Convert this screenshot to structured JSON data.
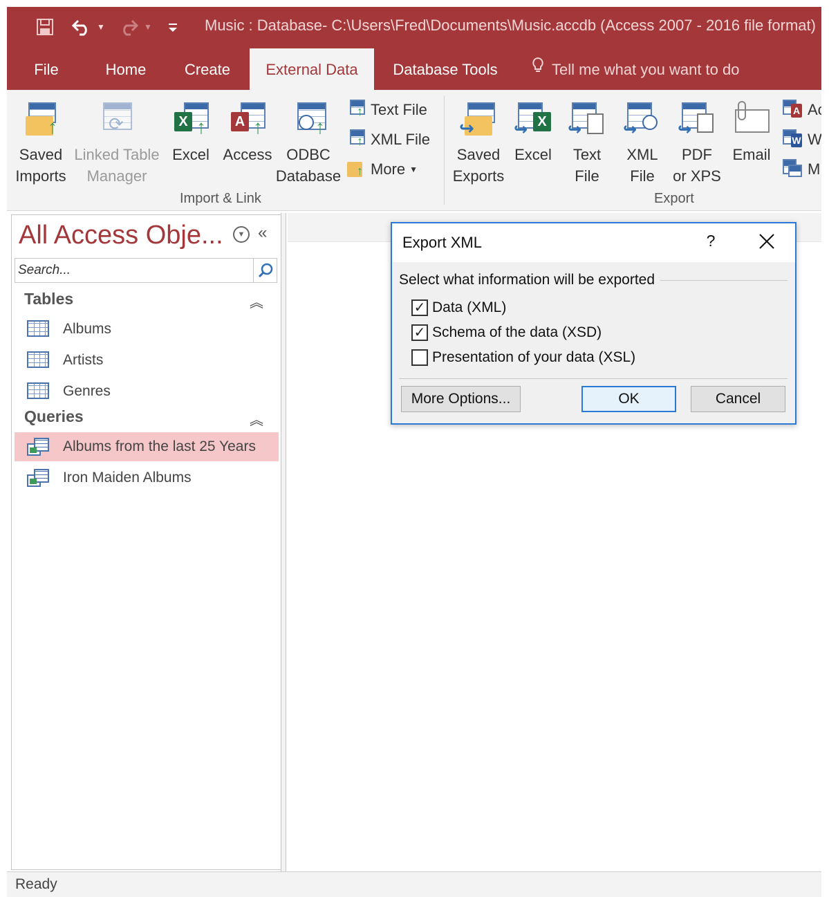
{
  "window": {
    "title": "Music : Database- C:\\Users\\Fred\\Documents\\Music.accdb (Access 2007 - 2016 file format)"
  },
  "quick_access": {
    "icons": [
      "save-icon",
      "undo-icon",
      "redo-icon",
      "customize-icon"
    ]
  },
  "ribbon": {
    "tabs": [
      {
        "label": "File",
        "active": false
      },
      {
        "label": "Home",
        "active": false
      },
      {
        "label": "Create",
        "active": false
      },
      {
        "label": "External Data",
        "active": true
      },
      {
        "label": "Database Tools",
        "active": false
      }
    ],
    "tell_me": "Tell me what you want to do",
    "import_group": {
      "label": "Import & Link",
      "saved_imports": {
        "line1": "Saved",
        "line2": "Imports"
      },
      "linked_table_manager": {
        "line1": "Linked Table",
        "line2": "Manager"
      },
      "excel": "Excel",
      "access": "Access",
      "odbc": {
        "line1": "ODBC",
        "line2": "Database"
      },
      "text_file": "Text File",
      "xml_file": "XML File",
      "more": "More"
    },
    "export_group": {
      "label": "Export",
      "saved_exports": {
        "line1": "Saved",
        "line2": "Exports"
      },
      "excel": "Excel",
      "text_file": {
        "line1": "Text",
        "line2": "File"
      },
      "xml_file": {
        "line1": "XML",
        "line2": "File"
      },
      "pdf": {
        "line1": "PDF",
        "line2": "or XPS"
      },
      "email": "Email",
      "access_partial": "Ac",
      "word_partial": "W",
      "more_partial": "M"
    }
  },
  "nav_pane": {
    "title": "All Access Obje...",
    "search_placeholder": "Search...",
    "sections": [
      {
        "label": "Tables",
        "items": [
          "Albums",
          "Artists",
          "Genres"
        ]
      },
      {
        "label": "Queries",
        "items": [
          "Albums from the last 25 Years",
          "Iron Maiden Albums"
        ],
        "selected": "Albums from the last 25 Years"
      }
    ]
  },
  "dialog": {
    "title": "Export XML",
    "help": "?",
    "group_label": "Select what information will be exported",
    "options": [
      {
        "label": "Data (XML)",
        "checked": true
      },
      {
        "label": "Schema of the data (XSD)",
        "checked": true
      },
      {
        "label": "Presentation of your data (XSL)",
        "checked": false
      }
    ],
    "buttons": {
      "more_options": "More Options...",
      "ok": "OK",
      "cancel": "Cancel"
    }
  },
  "status": {
    "text": "Ready"
  },
  "colors": {
    "brand": "#a4373a",
    "selected_item": "#f6c7c9",
    "dialog_accent": "#2b79d6"
  }
}
